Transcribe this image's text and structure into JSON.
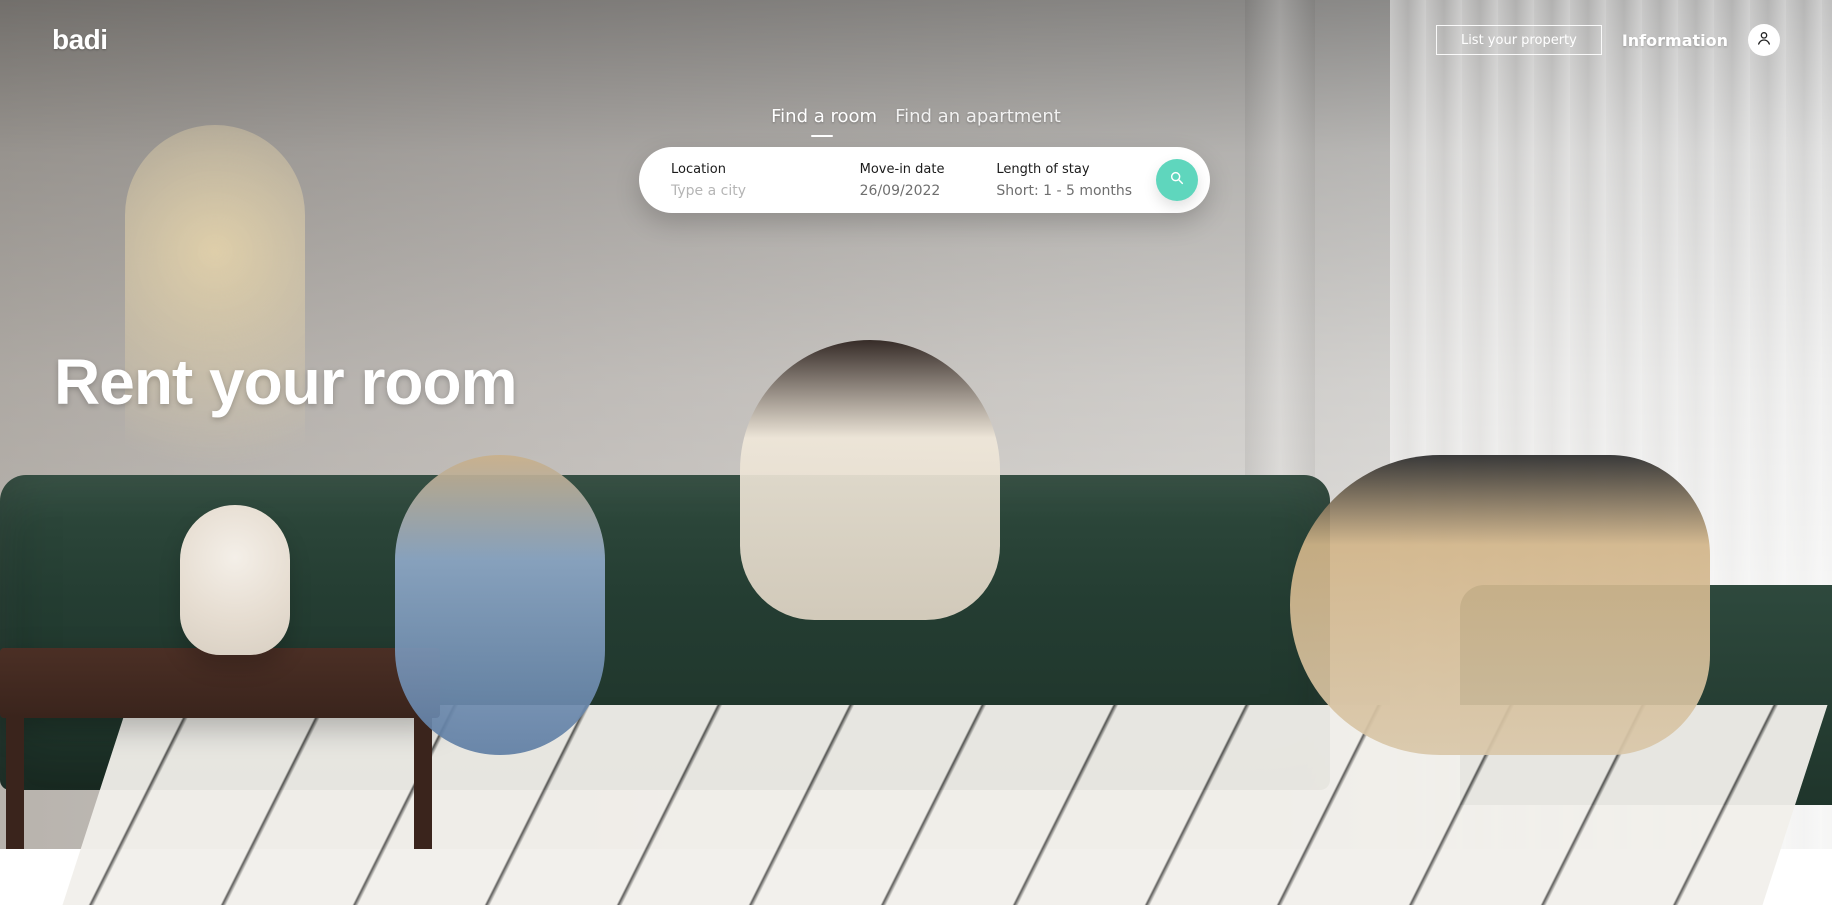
{
  "brand": {
    "logo_text": "badi",
    "accent": "#5fd6bd"
  },
  "header": {
    "list_property_label": "List your property",
    "information_label": "Information",
    "avatar_icon": "user-icon"
  },
  "tabs": [
    {
      "label": "Find a room",
      "active": true
    },
    {
      "label": "Find an apartment",
      "active": false
    }
  ],
  "search": {
    "location": {
      "label": "Location",
      "placeholder": "Type a city",
      "value": ""
    },
    "move_in": {
      "label": "Move-in date",
      "value": "26/09/2022"
    },
    "stay": {
      "label": "Length of stay",
      "value": "Short: 1 - 5 months"
    },
    "search_icon": "search-icon"
  },
  "hero": {
    "headline": "Rent your room"
  }
}
